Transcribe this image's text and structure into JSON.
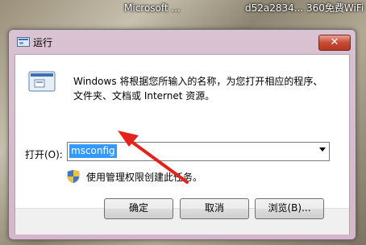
{
  "taskbar": {
    "app": "Microsoft ...",
    "wifi_id": "d52a2834...",
    "wifi_name": "360免费WiFi"
  },
  "dialog": {
    "title": "运行",
    "close_symbol": "✕",
    "description_line1": "Windows 将根据您所输入的名称，为您打开相应的程序、",
    "description_line2": "文件夹、文档或 Internet 资源。",
    "open_label": "打开(O):",
    "open_value": "msconfig",
    "admin_note": "使用管理权限创建此任务。",
    "buttons": {
      "ok": "确定",
      "cancel": "取消",
      "browse": "浏览(B)..."
    }
  },
  "annotation": {
    "arrow_color": "#e3231b"
  }
}
